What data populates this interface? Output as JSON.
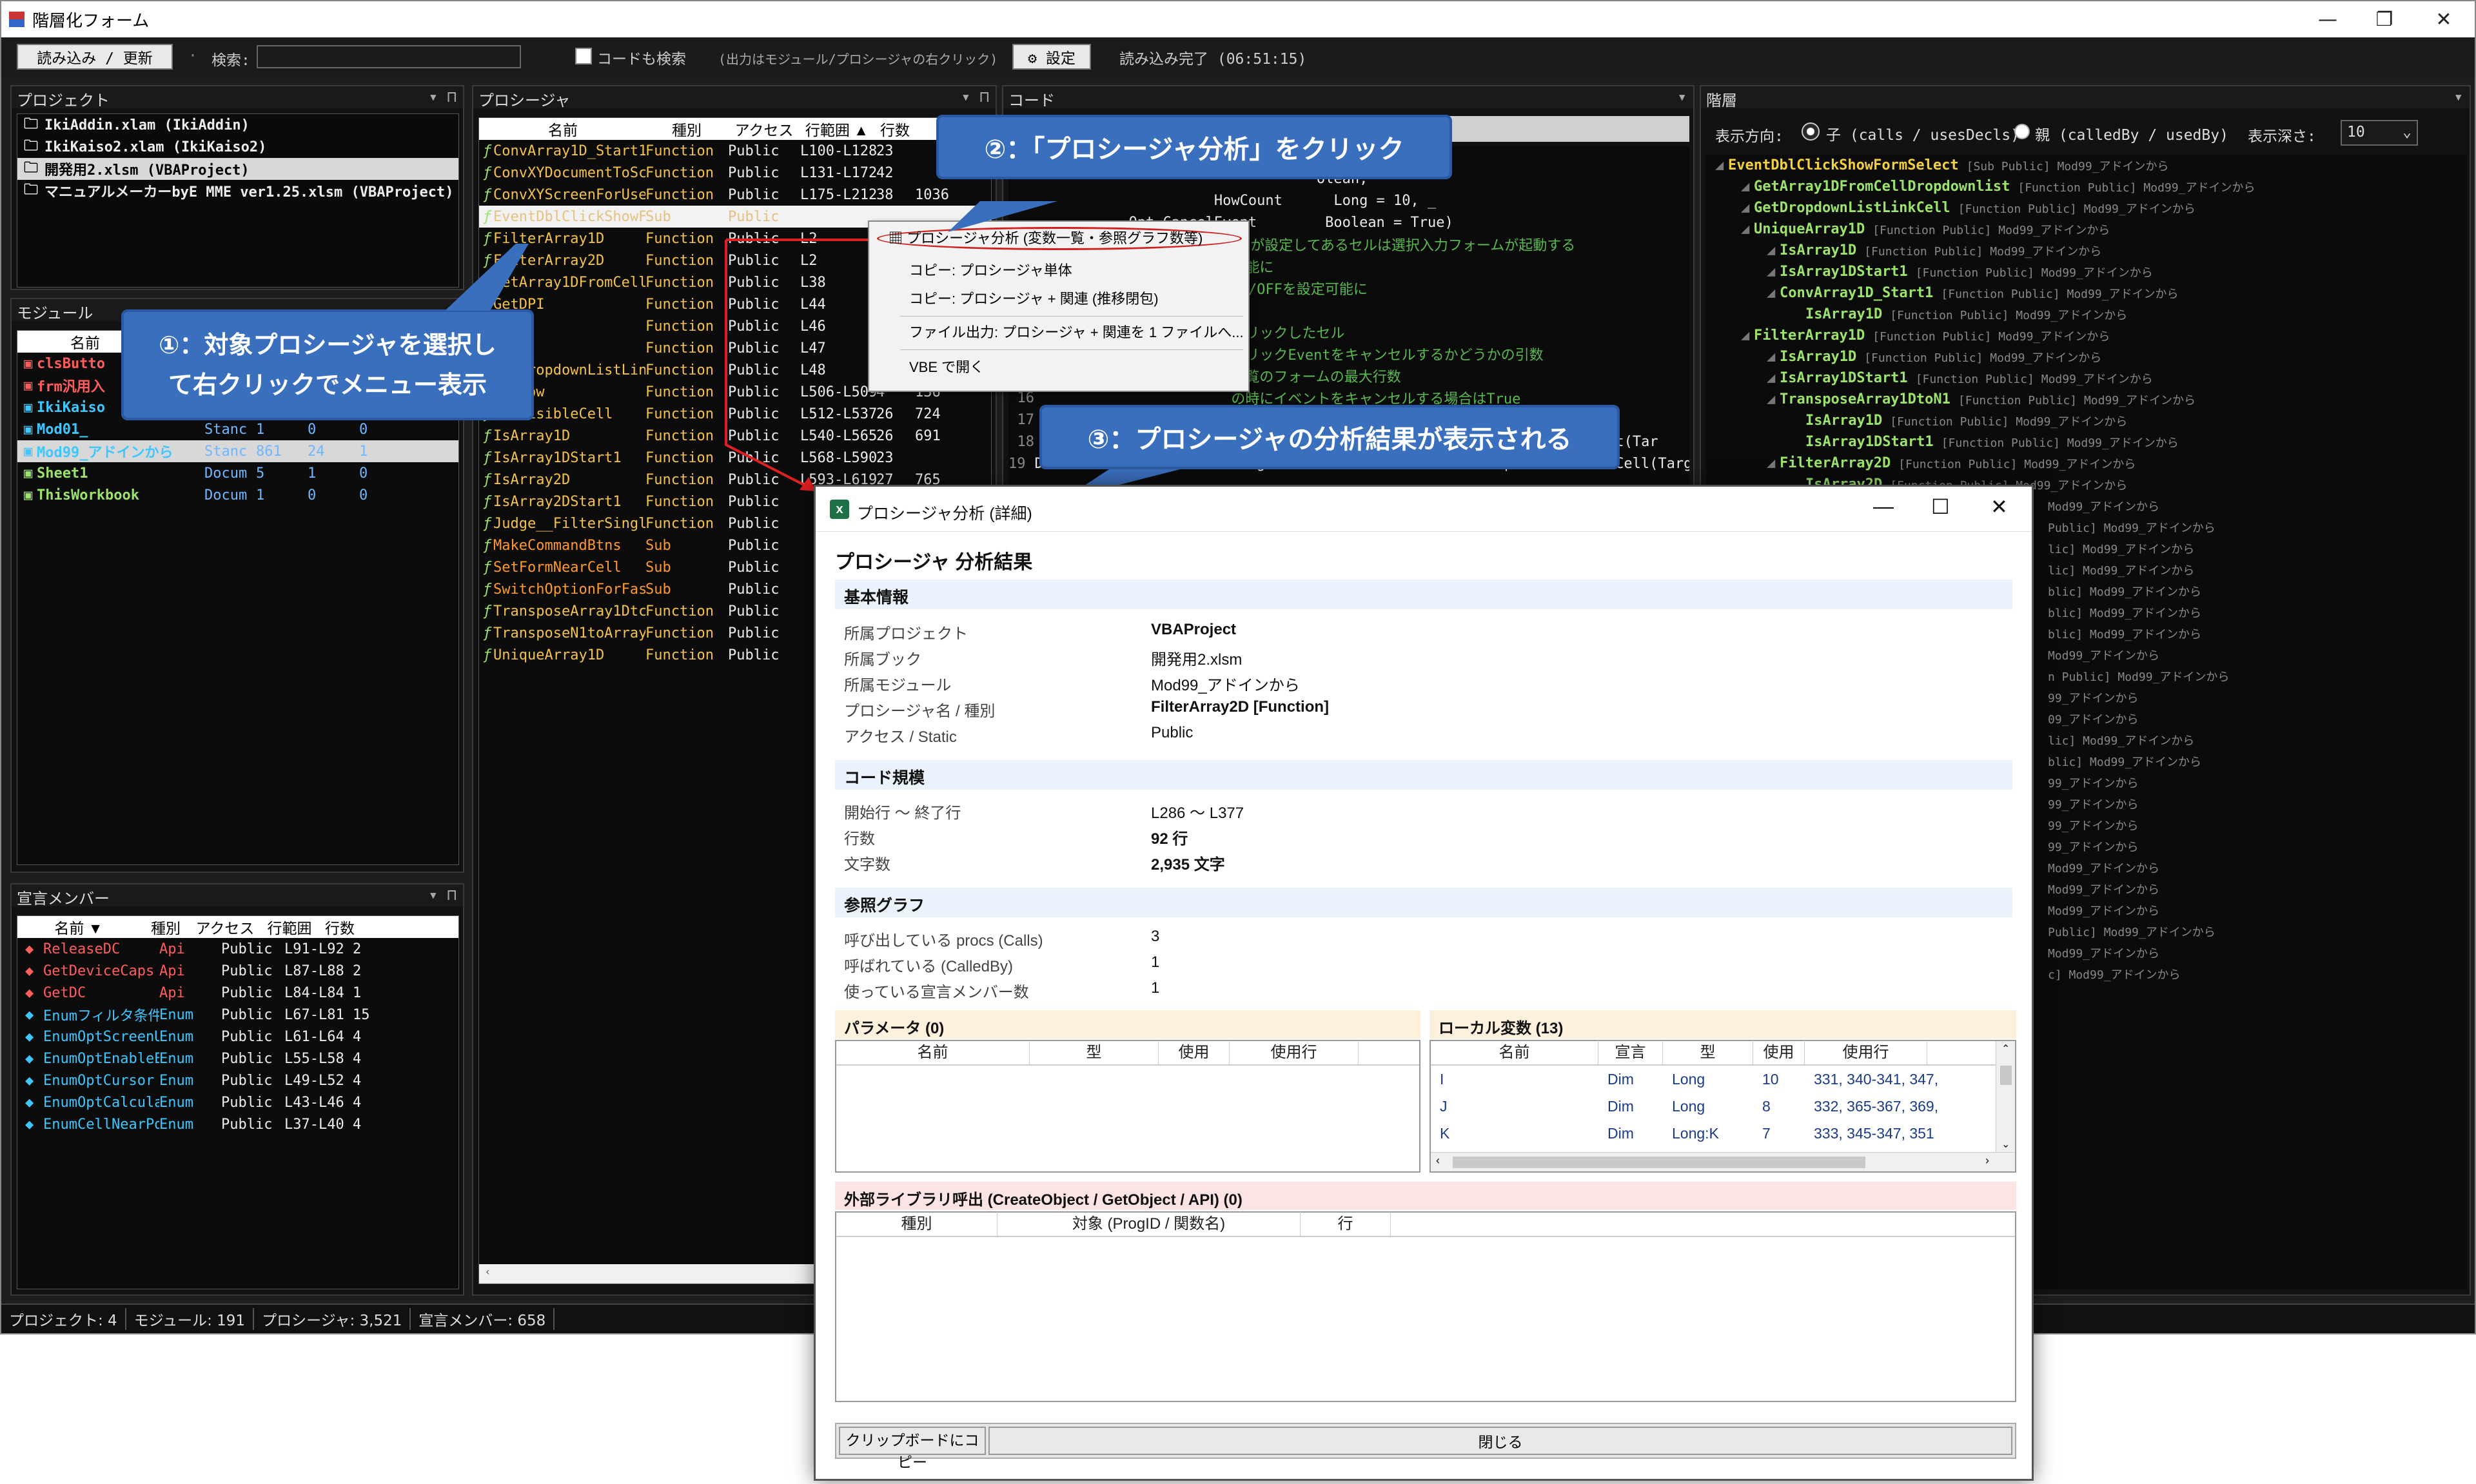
{
  "window": {
    "title": "階層化フォーム",
    "min": "—",
    "max": "❐",
    "close": "✕"
  },
  "toolbar": {
    "reload": "読み込み / 更新",
    "search_label": "検索:",
    "search_value": "",
    "code_search": "コードも検索",
    "output_note": "(出力はモジュール/プロシージャの右クリック)",
    "settings": "設定",
    "status": "読み込み完了 (06:51:15)"
  },
  "project_panel": {
    "title": "プロジェクト",
    "items": [
      "IkiAddin.xlam (IkiAddin)",
      "IkiKaiso2.xlam (IkiKaiso2)",
      "開発用2.xlsm (VBAProject)",
      "マニュアルメーカーbyE MME ver1.25.xlsm (VBAProject)"
    ]
  },
  "module_panel": {
    "title": "モジュール",
    "header": [
      "名前"
    ],
    "rows": [
      {
        "name": "clsButto",
        "type": "",
        "a": "",
        "b": "",
        "c": ""
      },
      {
        "name": "frm汎用入",
        "type": "",
        "a": "",
        "b": "",
        "c": ""
      },
      {
        "name": "IkiKaiso",
        "type": "",
        "a": "",
        "b": "",
        "c": ""
      },
      {
        "name": "Mod01_",
        "type": "Stanc",
        "a": "1",
        "b": "0",
        "c": "0"
      },
      {
        "name": "Mod99_アドインから",
        "type": "Stanc",
        "a": "861",
        "b": "24",
        "c": "1"
      },
      {
        "name": "Sheet1",
        "type": "Docum",
        "a": "5",
        "b": "1",
        "c": "0"
      },
      {
        "name": "ThisWorkbook",
        "type": "Docum",
        "a": "1",
        "b": "0",
        "c": "0"
      }
    ]
  },
  "decl_panel": {
    "title": "宣言メンバー",
    "header": [
      "名前 ▼",
      "種別",
      "アクセス",
      "行範囲",
      "行数"
    ],
    "rows": [
      {
        "name": "ReleaseDC",
        "kind": "Api",
        "access": "Public",
        "range": "L91-L92",
        "lines": "2"
      },
      {
        "name": "GetDeviceCaps",
        "kind": "Api",
        "access": "Public",
        "range": "L87-L88",
        "lines": "2"
      },
      {
        "name": "GetDC",
        "kind": "Api",
        "access": "Public",
        "range": "L84-L84",
        "lines": "1"
      },
      {
        "name": "Enumフィルタ条件",
        "kind": "Enum",
        "access": "Public",
        "range": "L67-L81",
        "lines": "15"
      },
      {
        "name": "EnumOptScreenUpdat",
        "kind": "Enum",
        "access": "Public",
        "range": "L61-L64",
        "lines": "4"
      },
      {
        "name": "EnumOptEnableEvent",
        "kind": "Enum",
        "access": "Public",
        "range": "L55-L58",
        "lines": "4"
      },
      {
        "name": "EnumOptCursor",
        "kind": "Enum",
        "access": "Public",
        "range": "L49-L52",
        "lines": "4"
      },
      {
        "name": "EnumOptCalculation",
        "kind": "Enum",
        "access": "Public",
        "range": "L43-L46",
        "lines": "4"
      },
      {
        "name": "EnumCellNearPositi",
        "kind": "Enum",
        "access": "Public",
        "range": "L37-L40",
        "lines": "4"
      }
    ]
  },
  "proc_panel": {
    "title": "プロシージャ",
    "header": [
      "名前",
      "種別",
      "アクセス",
      "行範囲 ▲",
      "行数"
    ],
    "rows": [
      {
        "name": "ConvArray1D_Start1",
        "kind": "Function",
        "access": "Public",
        "range": "L100-L128",
        "lines": "23"
      },
      {
        "name": "ConvXYDocumentToSc",
        "kind": "Function",
        "access": "Public",
        "range": "L131-L172",
        "lines": "42"
      },
      {
        "name": "ConvXYScreenForUse",
        "kind": "Function",
        "access": "Public",
        "range": "L175-L212",
        "lines": "38"
      },
      {
        "name": "EventDblClickShowF",
        "kind": "Sub",
        "access": "Public",
        "range": "",
        "lines": ""
      },
      {
        "name": "FilterArray1D",
        "kind": "Function",
        "access": "Public",
        "range": "L2",
        "lines": ""
      },
      {
        "name": "FilterArray2D",
        "kind": "Function",
        "access": "Public",
        "range": "L2",
        "lines": ""
      },
      {
        "name": "GetArray1DFromCell",
        "kind": "Function",
        "access": "Public",
        "range": "L38",
        "lines": ""
      },
      {
        "name": "GetDPI",
        "kind": "Function",
        "access": "Public",
        "range": "L44",
        "lines": ""
      },
      {
        "name": "GetX",
        "kind": "Function",
        "access": "Public",
        "range": "L46",
        "lines": ""
      },
      {
        "name": "GetY",
        "kind": "Function",
        "access": "Public",
        "range": "L47",
        "lines": ""
      },
      {
        "name": "GetDropdownListLin",
        "kind": "Function",
        "access": "Public",
        "range": "L48",
        "lines": ""
      },
      {
        "name": "GetRow",
        "kind": "Function",
        "access": "Public",
        "range": "L506-L509",
        "lines": "4"
      },
      {
        "name": "GetVisibleCell",
        "kind": "Function",
        "access": "Public",
        "range": "L512-L537",
        "lines": "26"
      },
      {
        "name": "IsArray1D",
        "kind": "Function",
        "access": "Public",
        "range": "L540-L565",
        "lines": "26"
      },
      {
        "name": "IsArray1DStart1",
        "kind": "Function",
        "access": "Public",
        "range": "L568-L590",
        "lines": "23"
      },
      {
        "name": "IsArray2D",
        "kind": "Function",
        "access": "Public",
        "range": "L593-L619",
        "lines": "27"
      },
      {
        "name": "IsArray2DStart1",
        "kind": "Function",
        "access": "Public",
        "range": "",
        "lines": ""
      },
      {
        "name": "Judge__FilterSingl",
        "kind": "Function",
        "access": "Public",
        "range": "",
        "lines": ""
      },
      {
        "name": "MakeCommandBtns",
        "kind": "Sub",
        "access": "Public",
        "range": "",
        "lines": ""
      },
      {
        "name": "SetFormNearCell",
        "kind": "Sub",
        "access": "Public",
        "range": "",
        "lines": ""
      },
      {
        "name": "SwitchOptionForFas",
        "kind": "Sub",
        "access": "Public",
        "range": "",
        "lines": ""
      },
      {
        "name": "TransposeArray1Dtc",
        "kind": "Function",
        "access": "Public",
        "range": "",
        "lines": ""
      },
      {
        "name": "TransposeN1toArray",
        "kind": "Function",
        "access": "Public",
        "range": "",
        "lines": ""
      },
      {
        "name": "UniqueArray1D",
        "kind": "Function",
        "access": "Public",
        "range": "",
        "lines": ""
      }
    ],
    "extra_col": [
      "",
      "",
      "1036",
      "",
      "",
      "",
      "",
      "",
      "",
      "",
      "",
      "136",
      "724",
      "691",
      "",
      "765"
    ]
  },
  "code_panel": {
    "title": "コード",
    "header": "blic] L215-246",
    "lines": [
      "                                ange, _",
      "                                olean,",
      "                    HowCount      Long = 10, _",
      "          Opt_CancelEvent        Boolean = True)",
      "'ダブルクリックすると入力規則が設定してあるセルは選択入力フォームが起動する",
      "                      可能に",
      "                      ON/OFFを設定可能に",
      "",
      "                      クリックしたセル",
      "                      クリックEventをキャンセルするかどうかの引数",
      "                      一覧のフォームの最大行数",
      "                      の時にイベントをキャンセルする場合はTrue",
      "",
      "ListCellValidation : CellValidation = GetArray1DFromCellDropdownlist(Tar",
      "Dim LinkListCell    As Range: Set LinkListCell = GetDropdownListLinkCell(Target)"
    ],
    "line_numbers": [
      "",
      "",
      "",
      "",
      "",
      "",
      "",
      "",
      "",
      "",
      "",
      "",
      "15",
      "16",
      "17",
      "18",
      "19"
    ]
  },
  "hier_panel": {
    "title": "階層",
    "direction_label": "表示方向:",
    "opt_child": "子 (calls / usesDecls)",
    "opt_parent": "親 (calledBy / usedBy)",
    "depth_label": "表示深さ:",
    "depth_value": "10",
    "nodes": [
      {
        "indent": 0,
        "name": "EventDblClickShowFormSelect",
        "meta": "[Sub Public] Mod99_アドインから",
        "color": "#f4d03f"
      },
      {
        "indent": 1,
        "name": "GetArray1DFromCellDropdownlist",
        "meta": "[Function Public] Mod99_アドインから",
        "color": "#9be36c"
      },
      {
        "indent": 1,
        "name": "GetDropdownListLinkCell",
        "meta": "[Function Public] Mod99_アドインから",
        "color": "#9be36c"
      },
      {
        "indent": 1,
        "name": "UniqueArray1D",
        "meta": "[Function Public] Mod99_アドインから",
        "color": "#9be36c"
      },
      {
        "indent": 2,
        "name": "IsArray1D",
        "meta": "[Function Public] Mod99_アドインから",
        "color": "#9be36c"
      },
      {
        "indent": 2,
        "name": "IsArray1DStart1",
        "meta": "[Function Public] Mod99_アドインから",
        "color": "#9be36c"
      },
      {
        "indent": 2,
        "name": "ConvArray1D_Start1",
        "meta": "[Function Public] Mod99_アドインから",
        "color": "#9be36c"
      },
      {
        "indent": 3,
        "name": "IsArray1D",
        "meta": "[Function Public] Mod99_アドインから",
        "color": "#9be36c"
      },
      {
        "indent": 1,
        "name": "FilterArray1D",
        "meta": "[Function Public] Mod99_アドインから",
        "color": "#9be36c"
      },
      {
        "indent": 2,
        "name": "IsArray1D",
        "meta": "[Function Public] Mod99_アドインから",
        "color": "#9be36c"
      },
      {
        "indent": 2,
        "name": "IsArray1DStart1",
        "meta": "[Function Public] Mod99_アドインから",
        "color": "#9be36c"
      },
      {
        "indent": 2,
        "name": "TransposeArray1DtoN1",
        "meta": "[Function Public] Mod99_アドインから",
        "color": "#9be36c"
      },
      {
        "indent": 3,
        "name": "IsArray1D",
        "meta": "[Function Public] Mod99_アドインから",
        "color": "#9be36c"
      },
      {
        "indent": 3,
        "name": "IsArray1DStart1",
        "meta": "[Function Public] Mod99_アドインから",
        "color": "#9be36c"
      },
      {
        "indent": 2,
        "name": "FilterArray2D",
        "meta": "[Function Public] Mod99_アドインから",
        "color": "#9be36c"
      },
      {
        "indent": 3,
        "name": "IsArray2D",
        "meta": "[Function Public] Mod99_アドインから",
        "color": "#9be36c"
      }
    ],
    "tail": [
      "Mod99_アドインから",
      "Public] Mod99_アドインから",
      "lic] Mod99_アドインから",
      "lic] Mod99_アドインから",
      "blic] Mod99_アドインから",
      "blic] Mod99_アドインから",
      "blic] Mod99_アドインから",
      "Mod99_アドインから",
      "n Public] Mod99_アドインから",
      "99_アドインから",
      "09_アドインから",
      "lic] Mod99_アドインから",
      "blic] Mod99_アドインから",
      "99_アドインから",
      "99_アドインから",
      "99_アドインから",
      "99_アドインから",
      "Mod99_アドインから",
      "Mod99_アドインから",
      "Mod99_アドインから",
      "Public] Mod99_アドインから",
      "Mod99_アドインから",
      "c] Mod99_アドインから"
    ]
  },
  "context_menu": {
    "items": [
      "プロシージャ分析 (変数一覧・参照グラフ数等)",
      "コピー: プロシージャ単体",
      "コピー: プロシージャ + 関連 (推移閉包)",
      "ファイル出力: プロシージャ + 関連を 1 ファイルへ...",
      "VBE で開く"
    ]
  },
  "callouts": {
    "c1": "①：対象プロシージャを選択し\nて右クリックでメニュー表示",
    "c2": "②：「プロシージャ分析」をクリック",
    "c3": "③：プロシージャの分析結果が表示される"
  },
  "dialog": {
    "title": "プロシージャ分析 (詳細)",
    "heading": "プロシージャ 分析結果",
    "sec_basic": "基本情報",
    "basic": [
      {
        "k": "所属プロジェクト",
        "v": "VBAProject",
        "bold": true
      },
      {
        "k": "所属ブック",
        "v": "開発用2.xlsm",
        "bold": false
      },
      {
        "k": "所属モジュール",
        "v": "Mod99_アドインから",
        "bold": false
      },
      {
        "k": "プロシージャ名 / 種別",
        "v": "FilterArray2D  [Function]",
        "bold": true
      },
      {
        "k": "アクセス / Static",
        "v": "Public",
        "bold": false
      }
    ],
    "sec_size": "コード規模",
    "size": [
      {
        "k": "開始行 ～ 終了行",
        "v": "L286 ～ L377",
        "bold": false
      },
      {
        "k": "行数",
        "v": "92 行",
        "bold": true
      },
      {
        "k": "文字数",
        "v": "2,935 文字",
        "bold": true
      }
    ],
    "sec_graph": "参照グラフ",
    "graph": [
      {
        "k": "呼び出している procs (Calls)",
        "v": "3",
        "bold": false
      },
      {
        "k": "呼ばれている (CalledBy)",
        "v": "1",
        "bold": false
      },
      {
        "k": "使っている宣言メンバー数",
        "v": "1",
        "bold": false
      }
    ],
    "params_title": "パラメータ (0)",
    "params_header": [
      "名前",
      "型",
      "使用",
      "使用行"
    ],
    "locals_title": "ローカル変数 (13)",
    "locals_header": [
      "名前",
      "宣言",
      "型",
      "使用",
      "使用行"
    ],
    "locals": [
      {
        "name": "I",
        "decl": "Dim",
        "type": "Long",
        "use": "10",
        "lines": "331, 340-341, 347,"
      },
      {
        "name": "J",
        "decl": "Dim",
        "type": "Long",
        "use": "8",
        "lines": "332, 365-367, 369,"
      },
      {
        "name": "K",
        "decl": "Dim",
        "type": "Long:K",
        "use": "7",
        "lines": "333, 345-347, 351"
      }
    ],
    "ext_title": "外部ライブラリ呼出 (CreateObject / GetObject / API)  (0)",
    "ext_header": [
      "種別",
      "対象 (ProgID / 関数名)",
      "行"
    ],
    "copy_btn": "クリップボードにコピー",
    "close_btn": "閉じる"
  },
  "statusbar": {
    "projects": "プロジェクト: 4",
    "modules": "モジュール: 191",
    "procs": "プロシージャ: 3,521",
    "decls": "宣言メンバー: 658"
  }
}
